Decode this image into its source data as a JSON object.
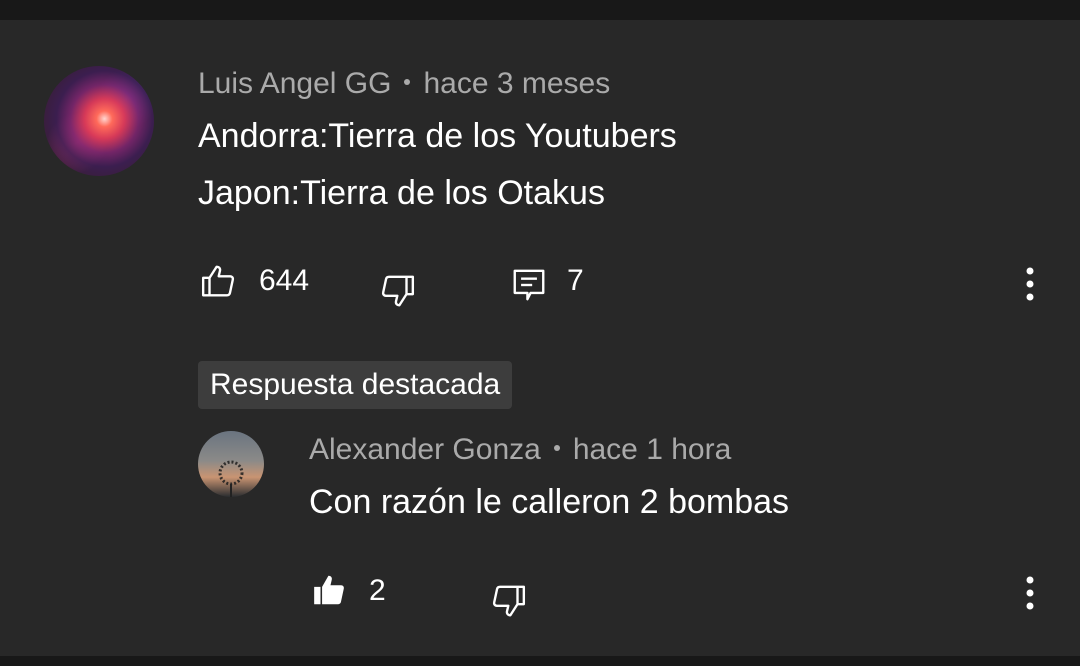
{
  "comment": {
    "author": "Luis Angel GG",
    "time": "hace 3 meses",
    "lines": [
      "Andorra:Tierra de los Youtubers",
      "Japon:Tierra de los Otakus"
    ],
    "likes": "644",
    "replies": "7"
  },
  "highlight_label": "Respuesta destacada",
  "reply": {
    "author": "Alexander Gonza",
    "time": "hace 1 hora",
    "text": "Con razón le calleron 2 bombas",
    "likes": "2"
  },
  "icons": {
    "like": "thumbs-up-outline-icon",
    "like_filled": "thumbs-up-filled-icon",
    "dislike": "thumbs-down-outline-icon",
    "reply": "comment-reply-icon",
    "more": "more-vertical-icon"
  },
  "colors": {
    "background": "#282828",
    "secondary_text": "#aaaaaa",
    "primary_text": "#ffffff",
    "badge_background": "#3d3d3d"
  }
}
